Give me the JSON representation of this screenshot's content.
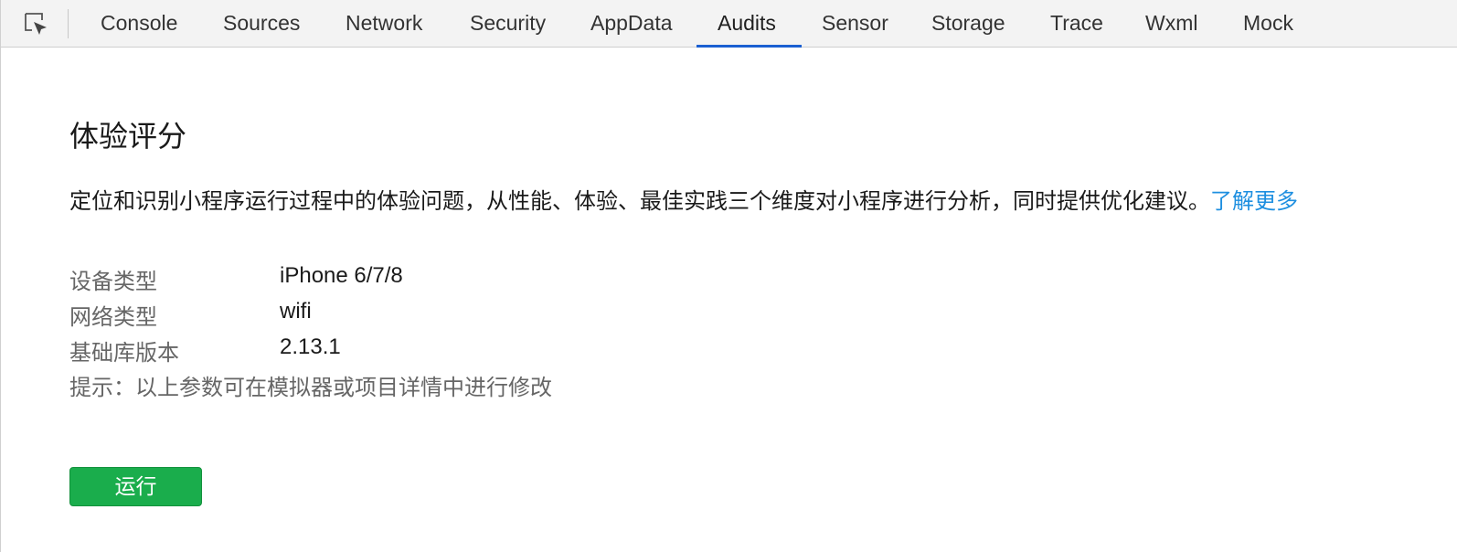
{
  "toolbar": {
    "inspect_icon": "element-inspect-icon"
  },
  "tabs": [
    {
      "label": "Console"
    },
    {
      "label": "Sources"
    },
    {
      "label": "Network"
    },
    {
      "label": "Security"
    },
    {
      "label": "AppData"
    },
    {
      "label": "Audits",
      "active": true
    },
    {
      "label": "Sensor"
    },
    {
      "label": "Storage"
    },
    {
      "label": "Trace"
    },
    {
      "label": "Wxml"
    },
    {
      "label": "Mock"
    }
  ],
  "colors": {
    "accent_underline": "#1a5fd1",
    "link": "#1e8fe0",
    "run_button": "#1aad4c"
  },
  "main": {
    "title": "体验评分",
    "description": "定位和识别小程序运行过程中的体验问题，从性能、体验、最佳实践三个维度对小程序进行分析，同时提供优化建议。",
    "learn_more": "了解更多",
    "info": [
      {
        "label": "设备类型",
        "value": "iPhone 6/7/8"
      },
      {
        "label": "网络类型",
        "value": "wifi"
      },
      {
        "label": "基础库版本",
        "value": "2.13.1"
      }
    ],
    "hint": "提示：以上参数可在模拟器或项目详情中进行修改",
    "run_label": "运行"
  }
}
